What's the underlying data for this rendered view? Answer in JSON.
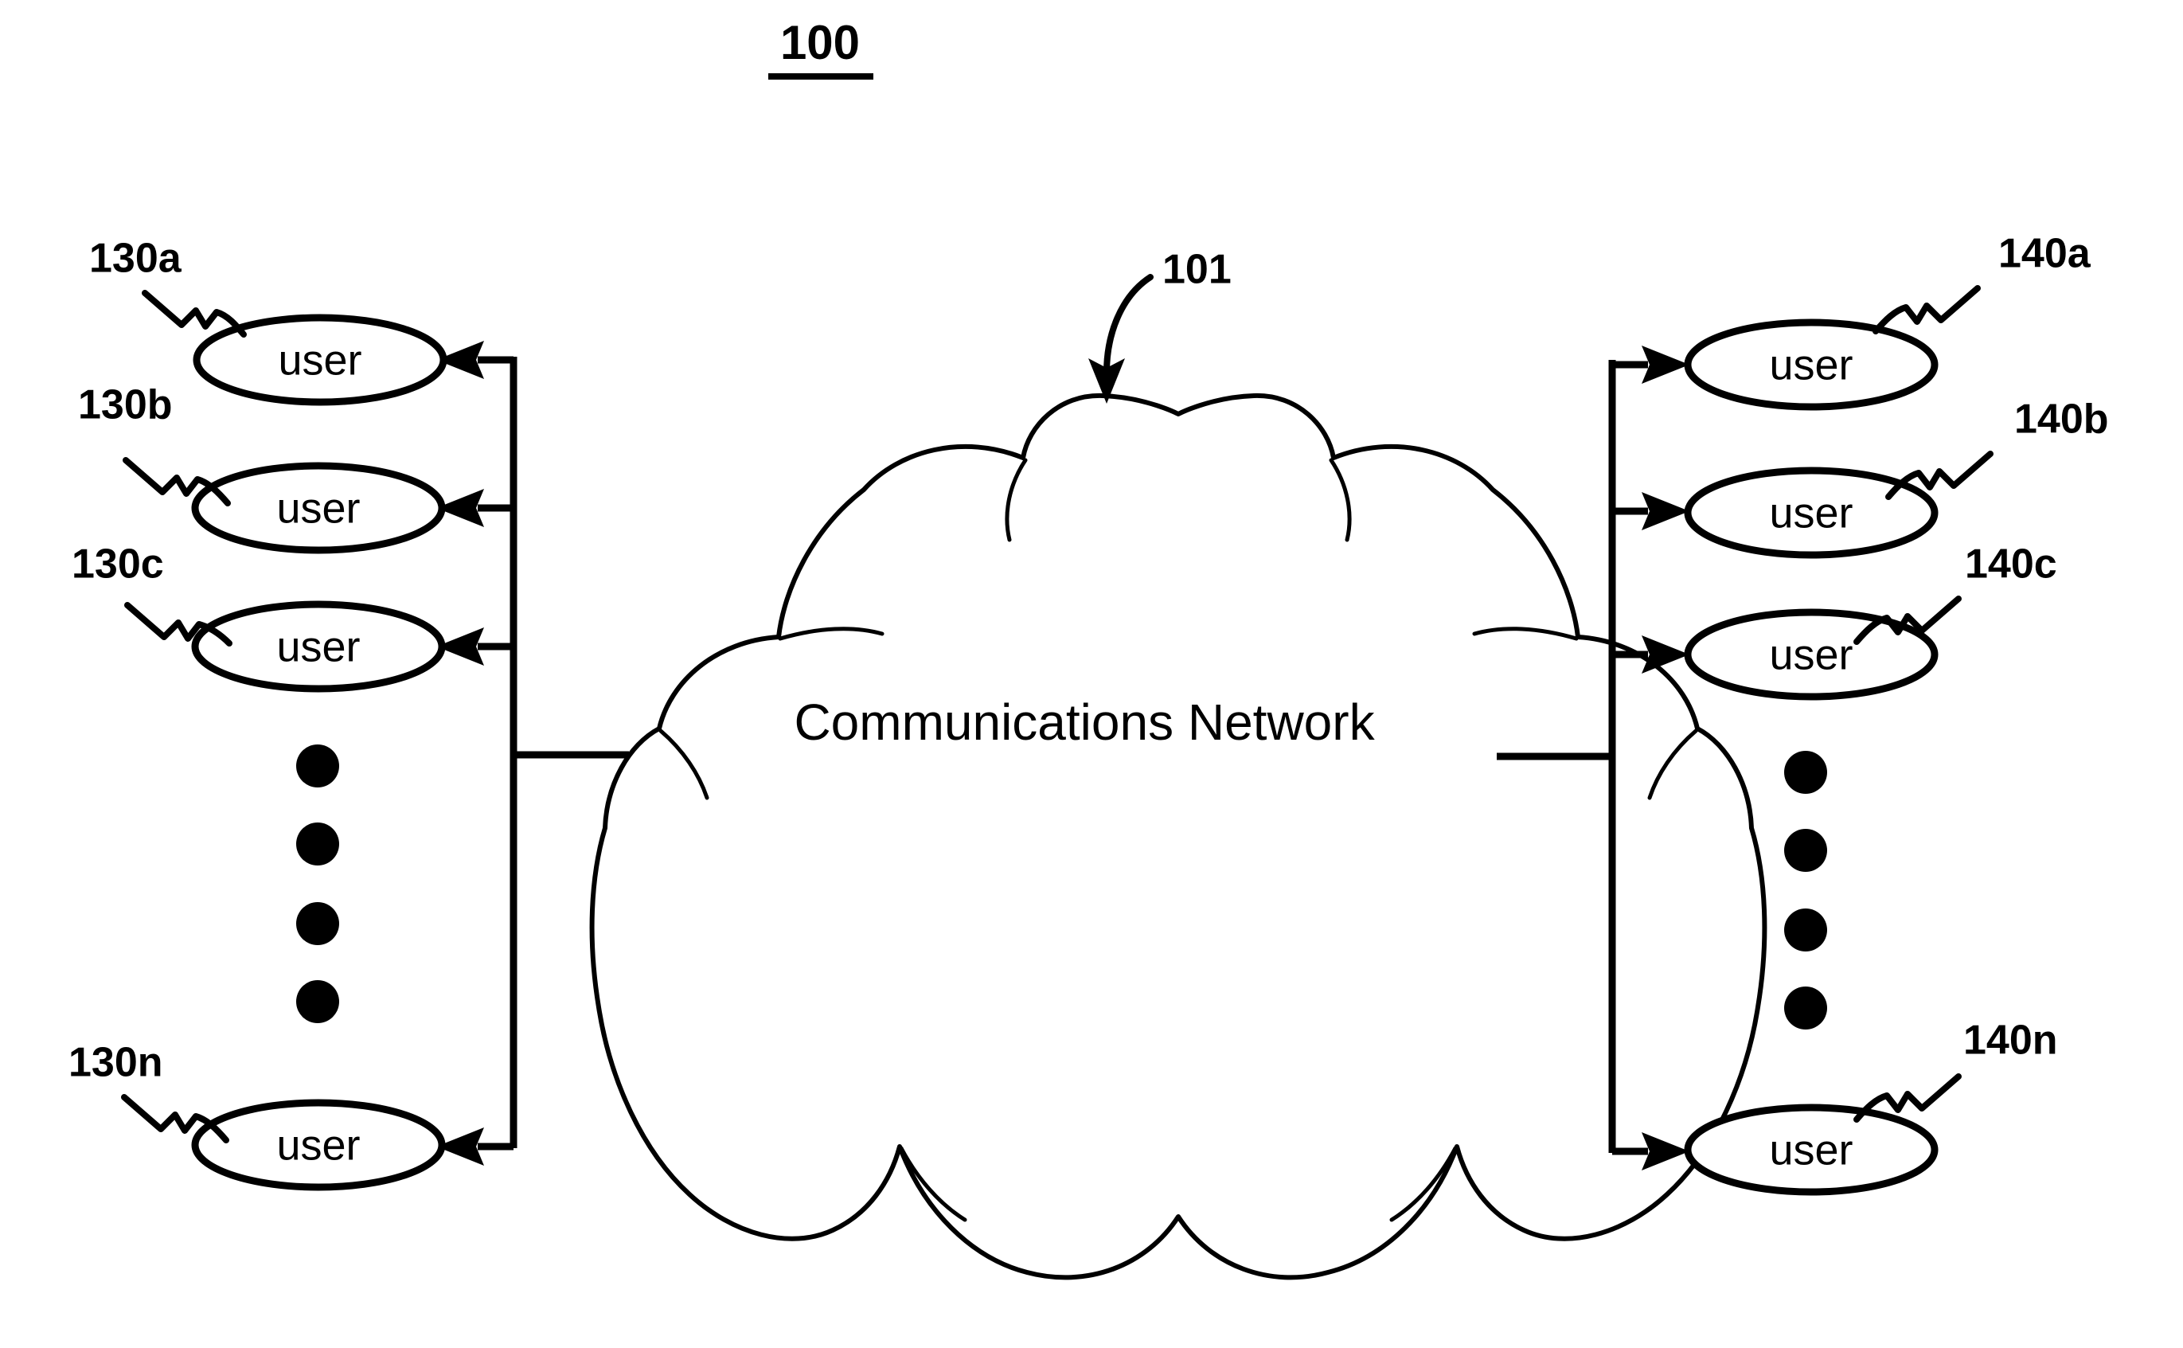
{
  "figure": {
    "number": "100",
    "type": "patent-block-diagram",
    "background_color": "#ffffff",
    "ink_color": "#000000"
  },
  "network": {
    "label": "Communications Network",
    "reference": "101",
    "shape": "cloud"
  },
  "left_group": {
    "group_reference_prefix": "130",
    "arrow_direction": "toward-user",
    "ellipsis_dot_count": 4,
    "nodes": [
      {
        "label": "user",
        "reference": "130a"
      },
      {
        "label": "user",
        "reference": "130b"
      },
      {
        "label": "user",
        "reference": "130c"
      },
      {
        "label": "user",
        "reference": "130n"
      }
    ]
  },
  "right_group": {
    "group_reference_prefix": "140",
    "arrow_direction": "toward-user",
    "ellipsis_dot_count": 4,
    "nodes": [
      {
        "label": "user",
        "reference": "140a"
      },
      {
        "label": "user",
        "reference": "140b"
      },
      {
        "label": "user",
        "reference": "140c"
      },
      {
        "label": "user",
        "reference": "140n"
      }
    ]
  }
}
